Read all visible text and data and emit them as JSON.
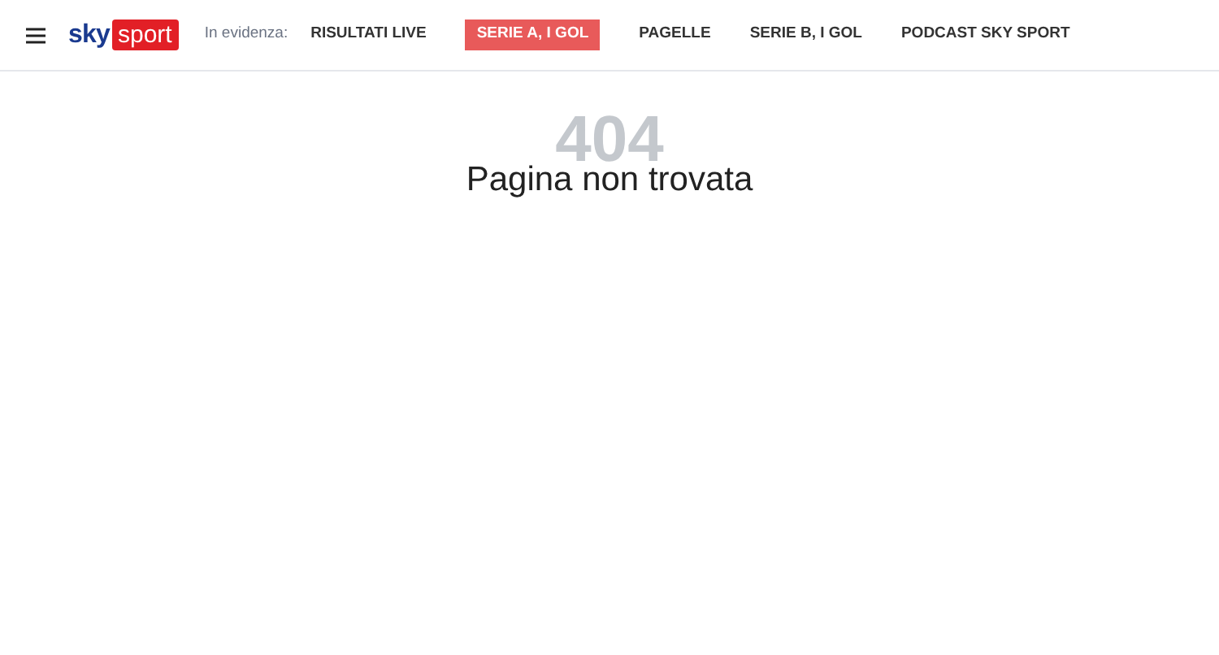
{
  "header": {
    "logo": {
      "brand": "sky",
      "product": "sport"
    },
    "highlight_label": "In evidenza:",
    "links": [
      {
        "label": "RISULTATI LIVE",
        "selected": false
      },
      {
        "label": "SERIE A, I GOL",
        "selected": true
      },
      {
        "label": "PAGELLE",
        "selected": false
      },
      {
        "label": "SERIE B, I GOL",
        "selected": false
      },
      {
        "label": "PODCAST SKY SPORT",
        "selected": false
      }
    ]
  },
  "error": {
    "code": "404",
    "title": "Pagina non trovata"
  }
}
